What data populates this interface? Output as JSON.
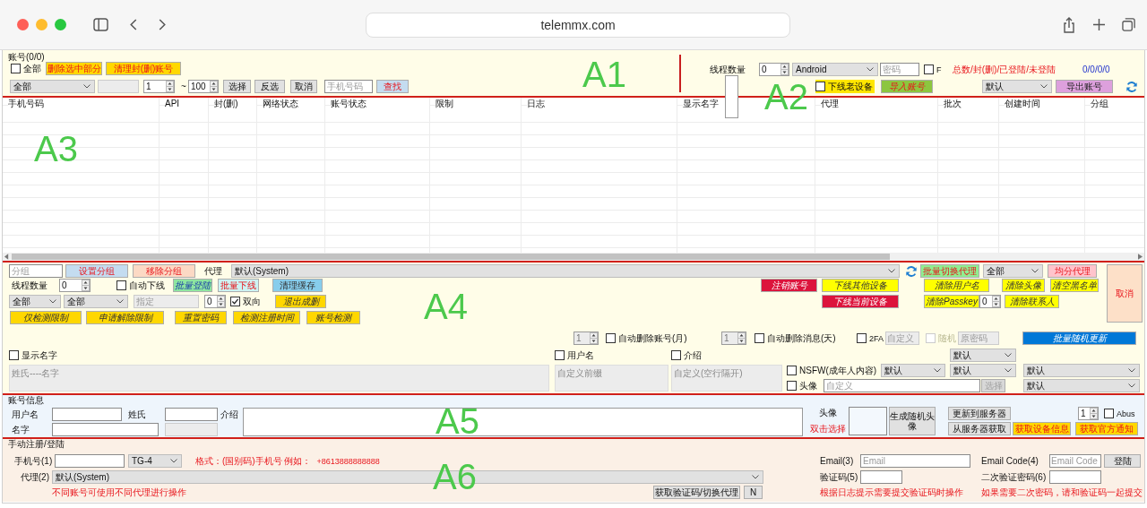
{
  "browser": {
    "url": "telemmx.com"
  },
  "accounts": {
    "title": "账号(0/0)",
    "select_all": {
      "label": "全部",
      "checked": false
    },
    "delete_selected": "删除选中部分",
    "clear_banned": "清理封(删)账号",
    "filter": "全部",
    "range_from": "1",
    "range_separator": "~",
    "range_to": "100",
    "select": "选择",
    "invert": "反选",
    "cancel": "取消",
    "phone_search": {
      "placeholder": "手机号码"
    },
    "find": "查找"
  },
  "import": {
    "threads_label": "线程数量",
    "threads": "0",
    "platform": "Android",
    "password": {
      "placeholder": "密码"
    },
    "f_option": {
      "label": "F",
      "checked": false
    },
    "totals_label": "总数/封(删)/已登陆/未登陆",
    "totals": "0/0/0/0",
    "offline_old_devices": {
      "label": "下线老设备",
      "checked": false
    },
    "import_button": "导入账号",
    "group": "默认",
    "export_button": "导出账号"
  },
  "table": {
    "columns": [
      "手机号码",
      "API",
      "封(删)",
      "网络状态",
      "账号状态",
      "限制",
      "日志",
      "显示名字",
      "代理",
      "批次",
      "创建时间",
      "分组"
    ]
  },
  "batch": {
    "group": {
      "placeholder": "分组"
    },
    "set_group": "设置分组",
    "remove_group": "移除分组",
    "proxy_label": "代理",
    "proxy": "默认(System)",
    "switch_proxy": "批量切换代理",
    "proxy_scope": "全部",
    "split_proxy": "均分代理",
    "cancel": "取消",
    "threads_label": "线程数量",
    "threads": "0",
    "auto_offline": {
      "label": "自动下线",
      "checked": false
    },
    "batch_login": "批量登陆",
    "batch_offline": "批量下线",
    "clear_cache": "清理缓存",
    "deregister": "注销账号",
    "offline_others": "下线其他设备",
    "clear_username": "清除用户名",
    "clear_avatar": "清除头像",
    "clear_blacklist": "清空黑名单",
    "filter_1": "全部",
    "filter_2": "全部",
    "target": {
      "placeholder": "指定",
      "disabled": true
    },
    "count": "0",
    "two_way": {
      "label": "双向",
      "checked": true
    },
    "exit_banned": "退出成删",
    "offline_current": "下线当前设备",
    "clear_passkey": "清除Passkey",
    "contacts_count": "0",
    "clear_contacts": "清除联系人",
    "check_limits": "仅检测限制",
    "appeal_limits": "申请解除限制",
    "reset_password": "重置密码",
    "check_reg_time": "检测注册时间",
    "check_account": "账号检测",
    "delete_accounts_months": {
      "value": "1",
      "disabled": true
    },
    "auto_delete_accounts": {
      "label": "自动删除账号(月)",
      "checked": false
    },
    "delete_messages_days": {
      "value": "1",
      "disabled": true
    },
    "auto_delete_messages": {
      "label": "自动删除消息(天)",
      "checked": false
    },
    "two_fa": {
      "label": "2FA",
      "checked": false
    },
    "two_fa_custom": {
      "placeholder": "自定义",
      "disabled": true
    },
    "random": {
      "label": "随机",
      "checked": false,
      "disabled": true
    },
    "old_password": {
      "placeholder": "原密码"
    },
    "batch_random_update": "批量随机更新",
    "show_name": {
      "label": "显示名字",
      "checked": false
    },
    "names": {
      "placeholder": "姓氏----名字"
    },
    "username": {
      "label": "用户名",
      "checked": false
    },
    "username_prefix": {
      "placeholder": "自定义前缀"
    },
    "bio": {
      "label": "介绍",
      "checked": false
    },
    "bio_text": {
      "placeholder": "自定义(空行隔开)"
    },
    "select_top": "默认",
    "nsfw": {
      "label": "NSFW(成年人内容)",
      "checked": false
    },
    "nsfw_select_1": "默认",
    "nsfw_select_2": "默认",
    "nsfw_select_3": "默认",
    "avatar": {
      "label": "头像",
      "checked": false
    },
    "avatar_path": {
      "placeholder": "自定义"
    },
    "avatar_choose": {
      "label": "选择",
      "disabled": true
    },
    "avatar_select": "默认"
  },
  "account_info": {
    "title": "账号信息",
    "username_label": "用户名",
    "surname_label": "姓氏",
    "bio_label": "介绍",
    "name_label": "名字",
    "avatar_label": "头像",
    "double_click_hint": "双击选择",
    "random_avatar": "生成随机头像",
    "update_server": "更新到服务器",
    "fetch_server": "从服务器获取",
    "count": "1",
    "abus": {
      "label": "Abus",
      "checked": false
    },
    "device_info": "获取设备信息",
    "official_notice": "获取官方通知"
  },
  "manual": {
    "title": "手动注册/登陆",
    "phone_label": "手机号(1)",
    "type": "TG-4",
    "format_hint": "格式：(国别码)手机号 例如：",
    "example": "+8613888888888",
    "proxy_label": "代理(2)",
    "proxy": "默认(System)",
    "proxy_hint": "不同账号可使用不同代理进行操作",
    "get_code": "获取验证码/切换代理",
    "n_button": "N",
    "email_label": "Email(3)",
    "email": {
      "placeholder": "Email"
    },
    "email_code_label": "Email Code(4)",
    "email_code": {
      "placeholder": "Email Code"
    },
    "login": "登陆",
    "code_label": "验证码(5)",
    "password2_label": "二次验证密码(6)",
    "code_hint": "根据日志提示需要提交验证码时操作",
    "password2_hint": "如果需要二次密码，请和验证码一起提交"
  },
  "annotations": [
    "A1",
    "A2",
    "A3",
    "A4",
    "A5",
    "A6"
  ]
}
